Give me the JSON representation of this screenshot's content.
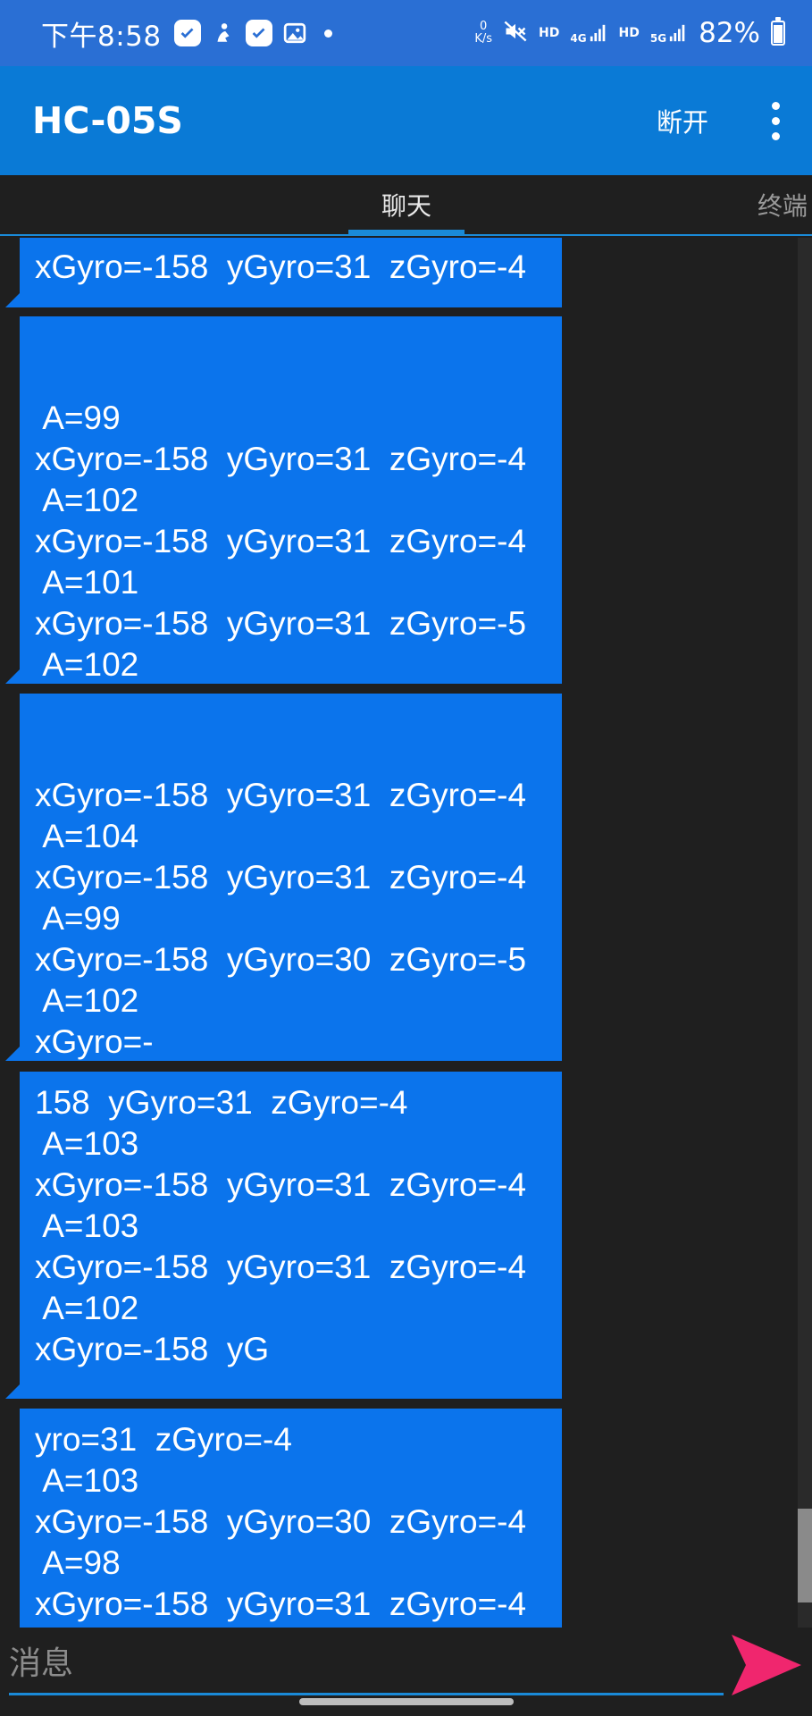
{
  "status_bar": {
    "time": "下午8:58",
    "speed_value": "0",
    "speed_unit": "K/s",
    "hd1": "HD",
    "net1": "4G",
    "hd2": "HD",
    "net2": "5G",
    "battery": "82%"
  },
  "app_bar": {
    "title": "HC-05S",
    "disconnect_label": "断开"
  },
  "tabs": [
    {
      "label": "聊天",
      "active": true
    },
    {
      "label": "终端",
      "active": false
    }
  ],
  "messages": [
    {
      "text": "xGyro=-158  yGyro=31  zGyro=-4"
    },
    {
      "text": "\n A=99\nxGyro=-158  yGyro=31  zGyro=-4\n A=102\nxGyro=-158  yGyro=31  zGyro=-4\n A=101\nxGyro=-158  yGyro=31  zGyro=-5\n A=102"
    },
    {
      "text": "\nxGyro=-158  yGyro=31  zGyro=-4\n A=104\nxGyro=-158  yGyro=31  zGyro=-4\n A=99\nxGyro=-158  yGyro=30  zGyro=-5\n A=102\nxGyro=-"
    },
    {
      "text": "158  yGyro=31  zGyro=-4\n A=103\nxGyro=-158  yGyro=31  zGyro=-4\n A=103\nxGyro=-158  yGyro=31  zGyro=-4\n A=102\nxGyro=-158  yG"
    },
    {
      "text": "yro=31  zGyro=-4\n A=103\nxGyro=-158  yGyro=30  zGyro=-4\n A=98\nxGyro=-158  yGyro=31  zGyro=-4"
    }
  ],
  "input": {
    "placeholder": "消息",
    "value": ""
  },
  "colors": {
    "status_bar": "#2a6fd4",
    "app_bar": "#0a7ad6",
    "bubble": "#0b74ec",
    "accent": "#1a8ad8",
    "send": "#f0266e"
  },
  "icons": [
    "checklist-icon",
    "person-icon",
    "checklist-icon",
    "image-icon",
    "mute-icon",
    "signal-icon",
    "more-vert-icon",
    "send-icon"
  ]
}
